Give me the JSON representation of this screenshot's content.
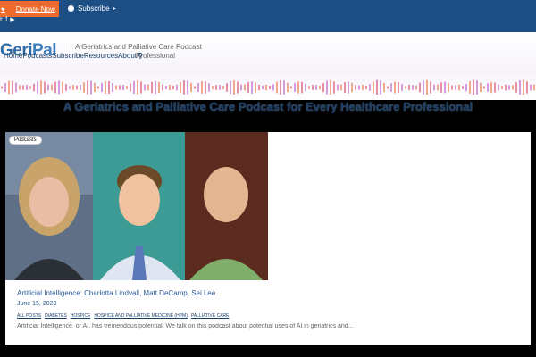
{
  "topbar": {
    "donate_label": "Donate Now",
    "subscribe_label": "Subscribe",
    "social_icons": [
      "twitter-icon",
      "facebook-icon",
      "youtube-icon"
    ],
    "bg_color": "#1d4f84",
    "donate_color": "#f06b2b"
  },
  "header": {
    "logo_part1": "Geri",
    "logo_part2": "Pal",
    "tagline": "A Geriatrics and Palliative Care Podcast",
    "tagline_cont": "Professional",
    "nav": [
      "Home",
      "Podcasts",
      "Subscribe",
      "Resources",
      "About"
    ]
  },
  "banner": {
    "text": "A Geriatrics and Palliative Care Podcast for Every Healthcare Professional"
  },
  "post": {
    "badge": "Podcasts",
    "title": "Artificial Intelligence: Charlotta Lindvall, Matt DeCamp, Sei Lee",
    "date": "June 15, 2023",
    "categories": [
      "All Posts",
      "Diabetes",
      "Hospice",
      "Hospice and Palliative Medicine (HPM)",
      "Palliative Care"
    ],
    "excerpt": "Artificial Intelligence, or AI, has tremendous potential.  We talk on this podcast about potential uses of AI in geriatrics and..."
  }
}
